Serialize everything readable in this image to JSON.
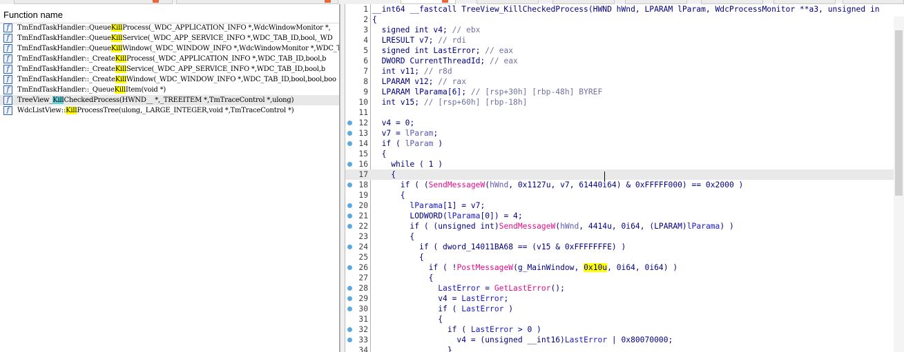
{
  "left_panel": {
    "header": "Function name",
    "functions": [
      {
        "pre": "TmEndTaskHandler::Queue",
        "hl": "Kill",
        "post": "Process(_WDC_APPLICATION_INFO *,WdcWindowMonitor *,",
        "selected": false
      },
      {
        "pre": "TmEndTaskHandler::Queue",
        "hl": "Kill",
        "post": "Service(_WDC_APP_SERVICE_INFO *,WDC_TAB_ID,bool,_WD",
        "selected": false
      },
      {
        "pre": "TmEndTaskHandler::Queue",
        "hl": "Kill",
        "post": "Window(_WDC_WINDOW_INFO *,WdcWindowMonitor *,WDC_TA",
        "selected": false
      },
      {
        "pre": "TmEndTaskHandler::_Create",
        "hl": "Kill",
        "post": "Process(_WDC_APPLICATION_INFO *,WDC_TAB_ID,bool,b",
        "selected": false
      },
      {
        "pre": "TmEndTaskHandler::_Create",
        "hl": "Kill",
        "post": "Service(_WDC_APP_SERVICE_INFO *,WDC_TAB_ID,bool,b",
        "selected": false
      },
      {
        "pre": "TmEndTaskHandler::_Create",
        "hl": "Kill",
        "post": "Window(_WDC_WINDOW_INFO *,WDC_TAB_ID,bool,bool,boo",
        "selected": false
      },
      {
        "pre": "TmEndTaskHandler::_Queue",
        "hl": "Kill",
        "post": "Item(void *)",
        "selected": false
      },
      {
        "pre": "TreeView_",
        "hl": "Kill",
        "post": "CheckedProcess(HWND__ *,_TREEITEM *,TmTraceControl *,ulong)",
        "selected": true
      },
      {
        "pre": "WdcListView::",
        "hl": "Kill",
        "post": "ProcessTree(ulong,_LARGE_INTEGER,void *,TmTraceControl *)",
        "selected": false
      }
    ]
  },
  "code_panel": {
    "lines": [
      {
        "n": "1",
        "bp": false,
        "cur": false,
        "segs": [
          [
            "n",
            "__int64 __fastcall TreeView_KillCheckedProcess(HWND hWnd, LPARAM lParam, WdcProcessMonitor **a3, unsigned in"
          ]
        ]
      },
      {
        "n": "2",
        "bp": false,
        "cur": false,
        "segs": [
          [
            "n",
            "{"
          ]
        ]
      },
      {
        "n": "3",
        "bp": false,
        "cur": false,
        "segs": [
          [
            "n",
            "  signed int v4; "
          ],
          [
            "c",
            "// ebx"
          ]
        ]
      },
      {
        "n": "4",
        "bp": false,
        "cur": false,
        "segs": [
          [
            "n",
            "  LRESULT v7; "
          ],
          [
            "c",
            "// rdi"
          ]
        ]
      },
      {
        "n": "5",
        "bp": false,
        "cur": false,
        "segs": [
          [
            "n",
            "  signed int LastError; "
          ],
          [
            "c",
            "// eax"
          ]
        ]
      },
      {
        "n": "6",
        "bp": false,
        "cur": false,
        "segs": [
          [
            "n",
            "  DWORD CurrentThreadId; "
          ],
          [
            "c",
            "// eax"
          ]
        ]
      },
      {
        "n": "7",
        "bp": false,
        "cur": false,
        "segs": [
          [
            "n",
            "  int v11; "
          ],
          [
            "c",
            "// r8d"
          ]
        ]
      },
      {
        "n": "8",
        "bp": false,
        "cur": false,
        "segs": [
          [
            "n",
            "  LPARAM v12; "
          ],
          [
            "c",
            "// rax"
          ]
        ]
      },
      {
        "n": "9",
        "bp": false,
        "cur": false,
        "segs": [
          [
            "n",
            "  LPARAM lParama[6]; "
          ],
          [
            "c",
            "// [rsp+30h] [rbp-48h] BYREF"
          ]
        ]
      },
      {
        "n": "10",
        "bp": false,
        "cur": false,
        "segs": [
          [
            "n",
            "  int v15; "
          ],
          [
            "c",
            "// [rsp+60h] [rbp-18h]"
          ]
        ]
      },
      {
        "n": "11",
        "bp": false,
        "cur": false,
        "segs": [
          [
            "n",
            ""
          ]
        ]
      },
      {
        "n": "12",
        "bp": true,
        "cur": false,
        "segs": [
          [
            "n",
            "  v4 = 0;"
          ]
        ]
      },
      {
        "n": "13",
        "bp": true,
        "cur": false,
        "segs": [
          [
            "n",
            "  v7 = "
          ],
          [
            "a",
            "lParam"
          ],
          [
            "n",
            ";"
          ]
        ]
      },
      {
        "n": "14",
        "bp": true,
        "cur": false,
        "segs": [
          [
            "n",
            "  if ( "
          ],
          [
            "a",
            "lParam"
          ],
          [
            "n",
            " )"
          ]
        ]
      },
      {
        "n": "15",
        "bp": false,
        "cur": false,
        "segs": [
          [
            "n",
            "  {"
          ]
        ]
      },
      {
        "n": "16",
        "bp": true,
        "cur": false,
        "segs": [
          [
            "n",
            "    while ( 1 )"
          ]
        ]
      },
      {
        "n": "17",
        "bp": false,
        "cur": true,
        "segs": [
          [
            "n",
            "    {"
          ]
        ]
      },
      {
        "n": "18",
        "bp": true,
        "cur": false,
        "segs": [
          [
            "n",
            "      if ( ("
          ],
          [
            "f",
            "SendMessageW"
          ],
          [
            "n",
            "("
          ],
          [
            "a",
            "hWnd"
          ],
          [
            "n",
            ", 0x1127u, v7, 61440i64) & 0xFFFFF000) == 0x2000 )"
          ]
        ]
      },
      {
        "n": "19",
        "bp": false,
        "cur": false,
        "segs": [
          [
            "n",
            "      {"
          ]
        ]
      },
      {
        "n": "20",
        "bp": true,
        "cur": false,
        "segs": [
          [
            "n",
            "        "
          ],
          [
            "v",
            "lParama"
          ],
          [
            "n",
            "[1] = v7;"
          ]
        ]
      },
      {
        "n": "21",
        "bp": true,
        "cur": false,
        "segs": [
          [
            "n",
            "        LODWORD("
          ],
          [
            "v",
            "lParama"
          ],
          [
            "n",
            "[0]) = 4;"
          ]
        ]
      },
      {
        "n": "22",
        "bp": true,
        "cur": false,
        "segs": [
          [
            "n",
            "        if ( (unsigned int)"
          ],
          [
            "f",
            "SendMessageW"
          ],
          [
            "n",
            "("
          ],
          [
            "a",
            "hWnd"
          ],
          [
            "n",
            ", 4414u, 0i64, (LPARAM)"
          ],
          [
            "v",
            "lParama"
          ],
          [
            "n",
            ") )"
          ]
        ]
      },
      {
        "n": "23",
        "bp": false,
        "cur": false,
        "segs": [
          [
            "n",
            "        {"
          ]
        ]
      },
      {
        "n": "24",
        "bp": true,
        "cur": false,
        "segs": [
          [
            "n",
            "          if ( dword_14011BA68 == (v15 & 0xFFFFFFFE) )"
          ]
        ]
      },
      {
        "n": "25",
        "bp": false,
        "cur": false,
        "segs": [
          [
            "n",
            "          {"
          ]
        ]
      },
      {
        "n": "26",
        "bp": true,
        "cur": false,
        "segs": [
          [
            "n",
            "            if ( !"
          ],
          [
            "f",
            "PostMessageW"
          ],
          [
            "n",
            "(g_MainWindow, "
          ],
          [
            "h",
            "0x10u"
          ],
          [
            "n",
            ", 0i64, 0i64) )"
          ]
        ]
      },
      {
        "n": "27",
        "bp": false,
        "cur": false,
        "segs": [
          [
            "n",
            "            {"
          ]
        ]
      },
      {
        "n": "28",
        "bp": true,
        "cur": false,
        "segs": [
          [
            "n",
            "              "
          ],
          [
            "v",
            "LastError"
          ],
          [
            "n",
            " = "
          ],
          [
            "f",
            "GetLastError"
          ],
          [
            "n",
            "();"
          ]
        ]
      },
      {
        "n": "29",
        "bp": true,
        "cur": false,
        "segs": [
          [
            "n",
            "              v4 = "
          ],
          [
            "v",
            "LastError"
          ],
          [
            "n",
            ";"
          ]
        ]
      },
      {
        "n": "30",
        "bp": true,
        "cur": false,
        "segs": [
          [
            "n",
            "              if ( "
          ],
          [
            "v",
            "LastError"
          ],
          [
            "n",
            " )"
          ]
        ]
      },
      {
        "n": "31",
        "bp": false,
        "cur": false,
        "segs": [
          [
            "n",
            "              {"
          ]
        ]
      },
      {
        "n": "32",
        "bp": true,
        "cur": false,
        "segs": [
          [
            "n",
            "                if ( "
          ],
          [
            "v",
            "LastError"
          ],
          [
            "n",
            " > 0 )"
          ]
        ]
      },
      {
        "n": "33",
        "bp": true,
        "cur": false,
        "segs": [
          [
            "n",
            "                  v4 = (unsigned __int16)"
          ],
          [
            "v",
            "LastError"
          ],
          [
            "n",
            " | 0x80070000;"
          ]
        ]
      },
      {
        "n": "34",
        "bp": false,
        "cur": false,
        "segs": [
          [
            "n",
            "                }"
          ]
        ]
      }
    ]
  },
  "colors": {
    "highlight": "#ffff00",
    "selected_highlight": "#5fcfd9",
    "function_call": "#e0108a",
    "keyword_text": "#000080",
    "comment": "#7070a0",
    "breakpoint_dot": "#5aa9e0"
  }
}
